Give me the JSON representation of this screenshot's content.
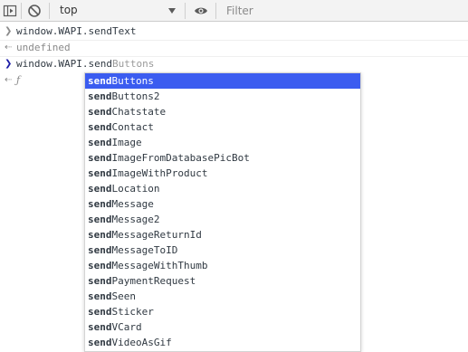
{
  "toolbar": {
    "context_value": "top",
    "filter_placeholder": "Filter",
    "icons": [
      "sidebar-toggle-icon",
      "clear-console-icon",
      "eye-icon",
      "dropdown-caret-icon"
    ]
  },
  "console": {
    "lines": [
      {
        "kind": "input",
        "text": "window.WAPI.sendText"
      },
      {
        "kind": "output",
        "text": "undefined"
      },
      {
        "kind": "current-input",
        "typed": "window.WAPI.send",
        "ghost": "Buttons"
      },
      {
        "kind": "output-function",
        "text": "ƒ"
      }
    ]
  },
  "suggestions": {
    "prefix": "send",
    "items": [
      {
        "rest": "Buttons",
        "selected": true
      },
      {
        "rest": "Buttons2"
      },
      {
        "rest": "Chatstate"
      },
      {
        "rest": "Contact"
      },
      {
        "rest": "Image"
      },
      {
        "rest": "ImageFromDatabasePicBot"
      },
      {
        "rest": "ImageWithProduct"
      },
      {
        "rest": "Location"
      },
      {
        "rest": "Message"
      },
      {
        "rest": "Message2"
      },
      {
        "rest": "MessageReturnId"
      },
      {
        "rest": "MessageToID"
      },
      {
        "rest": "MessageWithThumb"
      },
      {
        "rest": "PaymentRequest"
      },
      {
        "rest": "Seen"
      },
      {
        "rest": "Sticker"
      },
      {
        "rest": "VCard"
      },
      {
        "rest": "VideoAsGif"
      }
    ]
  },
  "colors": {
    "selection": "#3b5cf0",
    "prompt": "#1a1aa6",
    "muted": "#8a8a8a"
  }
}
